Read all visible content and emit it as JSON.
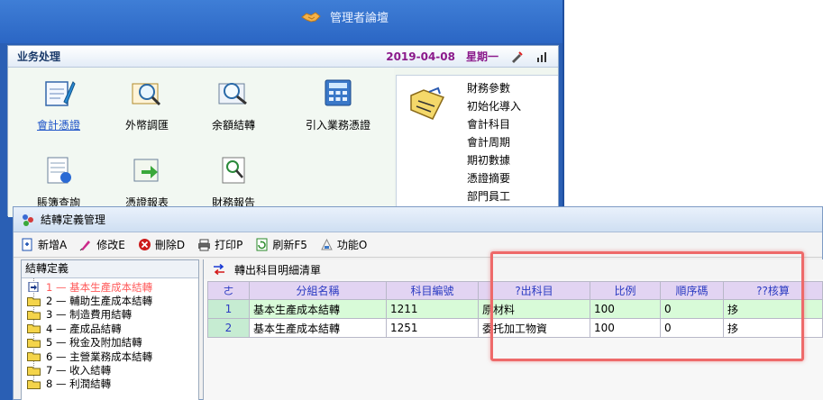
{
  "app": {
    "title": "管理者論壇"
  },
  "business": {
    "title": "业务处理",
    "date": "2019-04-08",
    "weekday": "星期一",
    "tiles": [
      {
        "label": "會計憑證",
        "icon": "voucher-pen-icon"
      },
      {
        "label": "外幣調匯",
        "icon": "currency-magnifier-icon"
      },
      {
        "label": "余額結轉",
        "icon": "balance-magnifier-icon"
      },
      {
        "label": "引入業務憑證",
        "icon": "calculator-icon"
      },
      {
        "label": "賬簿查詢",
        "icon": "ledger-query-icon"
      },
      {
        "label": "憑證報表",
        "icon": "voucher-report-icon"
      },
      {
        "label": "財務報告",
        "icon": "finance-report-icon"
      }
    ],
    "config_items": [
      "財務參數",
      "初始化導入",
      "會計科目",
      "會計周期",
      "期初數據",
      "憑證摘要",
      "部門員工"
    ]
  },
  "window": {
    "title": "結轉定義管理",
    "toolbar": [
      {
        "label": "新增A",
        "icon": "new-doc-icon",
        "color": "#1a4fb0"
      },
      {
        "label": "修改E",
        "icon": "edit-pen-icon",
        "color": "#cc2a8a"
      },
      {
        "label": "刪除D",
        "icon": "delete-icon",
        "color": "#cc1a1a"
      },
      {
        "label": "打印P",
        "icon": "printer-icon",
        "color": "#333333"
      },
      {
        "label": "刷新F5",
        "icon": "refresh-icon",
        "color": "#2a8a2a"
      },
      {
        "label": "功能O",
        "icon": "function-icon",
        "color": "#888888"
      }
    ],
    "tree": {
      "header": "結轉定義",
      "items": [
        "1 — 基本生產成本結轉",
        "2 — 輔助生產成本結轉",
        "3 — 制造費用結轉",
        "4 — 產成品結轉",
        "5 — 稅金及附加結轉",
        "6 — 主營業務成本結轉",
        "7 — 收入結轉",
        "8 — 利潤結轉"
      ],
      "selected_index": 0
    },
    "grid": {
      "caption": "轉出科目明細清單",
      "columns": [
        "ㄜ",
        "分組名稱",
        "科目編號",
        "?出科目",
        "比例",
        "順序碼",
        "??核算"
      ],
      "rows": [
        [
          "1",
          "基本生產成本結轉",
          "1211",
          "原材料",
          "100",
          "0",
          "拸"
        ],
        [
          "2",
          "基本生產成本結轉",
          "1251",
          "委托加工物資",
          "100",
          "0",
          "拸"
        ]
      ]
    }
  },
  "colors": {
    "highlight": "#ee6a6a",
    "header_bg": "#e2d4f2",
    "selected_row": "#d8fbd8"
  }
}
